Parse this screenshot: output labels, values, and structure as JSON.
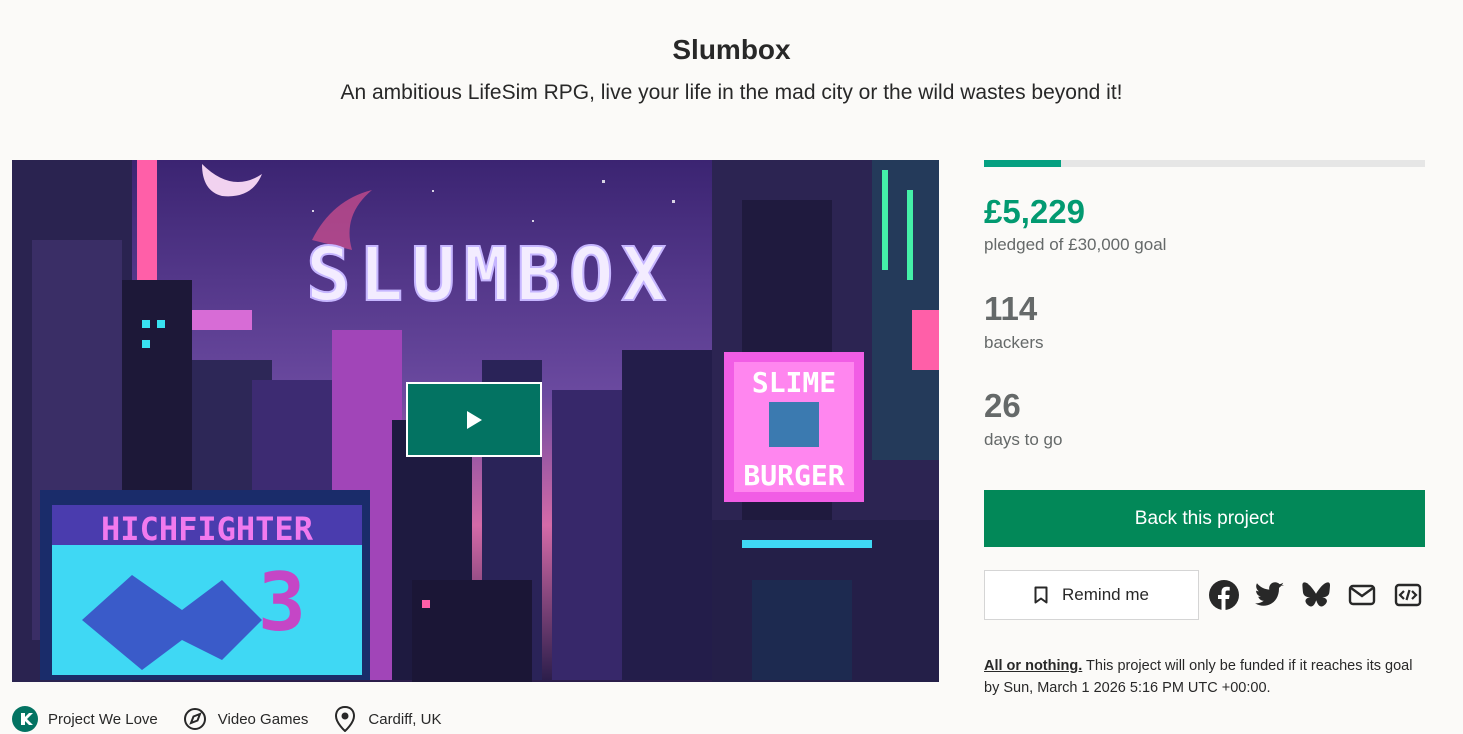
{
  "project": {
    "title": "Slumbox",
    "blurb": "An ambitious LifeSim RPG, live your life in the mad city or the wild wastes beyond it!"
  },
  "video": {
    "art_text": {
      "logo": "SLUMBOX",
      "sign_left": "HICHFIGHTER",
      "sign_left_num": "3",
      "sign_right_top": "SLIME",
      "sign_right_bottom": "BURGER"
    },
    "play_icon": "play-icon"
  },
  "meta": {
    "badge": {
      "label": "Project We Love",
      "icon": "kickstarter-badge-icon"
    },
    "category": {
      "label": "Video Games",
      "icon": "compass-icon"
    },
    "location": {
      "label": "Cardiff, UK",
      "icon": "location-pin-icon"
    }
  },
  "stats": {
    "progress_fraction": 0.174,
    "pledged": "£5,229",
    "pledged_label": "pledged of £30,000 goal",
    "backers": "114",
    "backers_label": "backers",
    "days": "26",
    "days_label": "days to go"
  },
  "actions": {
    "back_label": "Back this project",
    "remind_label": "Remind me",
    "remind_icon": "bookmark-icon",
    "share_icons": [
      "facebook-icon",
      "twitter-icon",
      "bluesky-icon",
      "email-icon",
      "embed-icon"
    ]
  },
  "funding_note": {
    "link": "All or nothing.",
    "text": " This project will only be funded if it reaches its goal by Sun, March 1 2026 5:16 PM UTC +00:00."
  },
  "colors": {
    "accent_green": "#029a71",
    "button_green": "#028858",
    "play_green": "#037362",
    "muted_text": "#656969"
  }
}
